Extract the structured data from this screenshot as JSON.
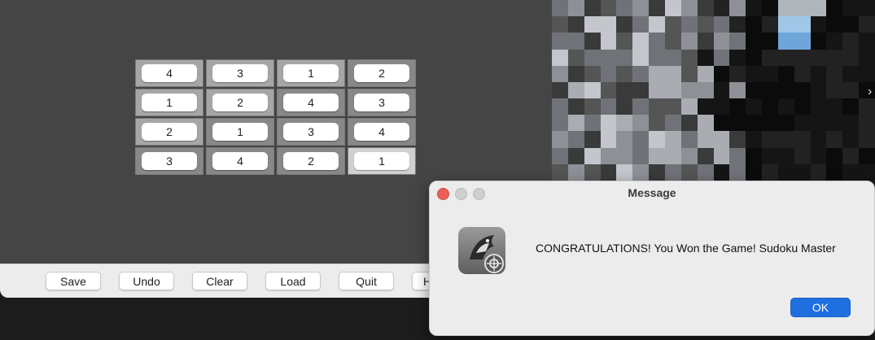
{
  "board": {
    "rows": [
      [
        "4",
        "3",
        "1",
        "2"
      ],
      [
        "1",
        "2",
        "4",
        "3"
      ],
      [
        "2",
        "1",
        "3",
        "4"
      ],
      [
        "3",
        "4",
        "2",
        "1"
      ]
    ]
  },
  "toolbar": {
    "save_label": "Save",
    "undo_label": "Undo",
    "clear_label": "Clear",
    "load_label": "Load",
    "quit_label": "Quit",
    "partial_label": "H"
  },
  "dialog": {
    "title": "Message",
    "message": "CONGRATULATIONS! You Won the Game! Sudoku Master",
    "ok_label": "OK",
    "icon": "java-duke-app-icon"
  },
  "colors": {
    "close": "#ec5f57",
    "minimize": "#cfcfcf",
    "zoom": "#cfcfcf",
    "ok_button": "#1f6fe0"
  }
}
